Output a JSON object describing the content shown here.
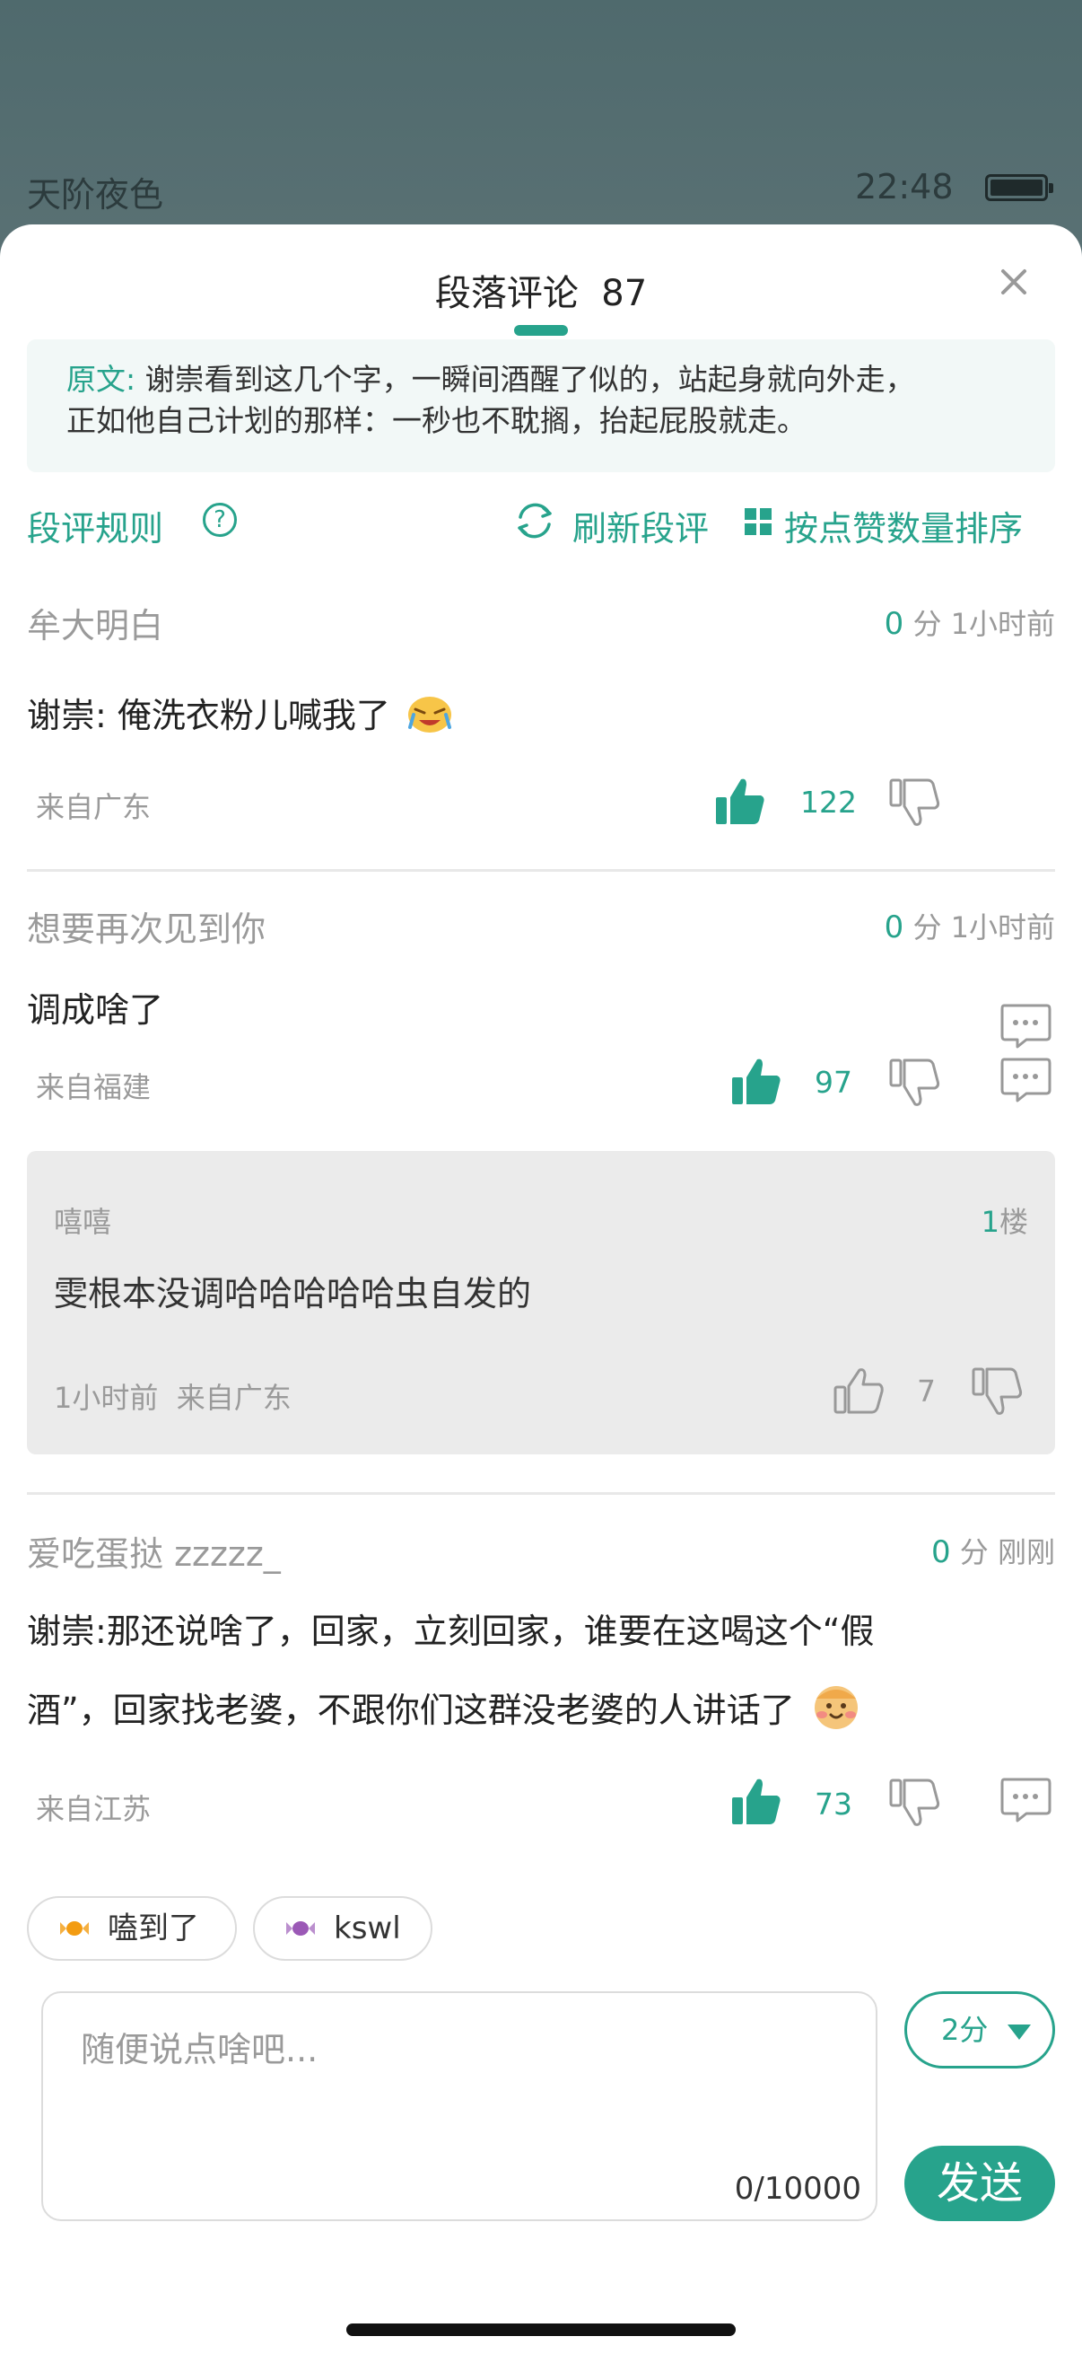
{
  "status": {
    "app_name": "天阶夜色",
    "time": "22:48"
  },
  "header": {
    "title": "段落评论",
    "count": "87"
  },
  "quote": {
    "label": "原文:",
    "text_line1": "谢崇看到这几个字，一瞬间酒醒了似的，站起身就向外走，",
    "text_line2": "正如他自己计划的那样：一秒也不耽搁，抬起屁股就走。"
  },
  "toolbar": {
    "rules": "段评规则",
    "help_icon": "?",
    "refresh": "刷新段评",
    "sort": "按点赞数量排序"
  },
  "comments": [
    {
      "user": "牟大明白",
      "score": "0",
      "score_unit": "分",
      "time": "1小时前",
      "body": "谢崇: 俺洗衣粉儿喊我了",
      "emoji": "crying-laughing-emoji",
      "location": "来自广东",
      "likes": "122"
    },
    {
      "user": "想要再次见到你",
      "score": "0",
      "score_unit": "分",
      "time": "1小时前",
      "body": "调成啥了",
      "location": "来自福建",
      "likes": "97",
      "reply": {
        "user": "嘻嘻",
        "floor_num": "1",
        "floor_unit": "楼",
        "body": "雯根本没调哈哈哈哈哈虫自发的",
        "time": "1小时前",
        "location": "来自广东",
        "likes": "7"
      }
    },
    {
      "user": "爱吃蛋挞 zzzzz_",
      "score": "0",
      "score_unit": "分",
      "time": "刚刚",
      "body_line1": "谢崇:那还说啥了，回家，立刻回家，谁要在这喝这个“假",
      "body_line2": "酒”，回家找老婆，不跟你们这群没老婆的人讲话了",
      "emoji": "tiger-emoji",
      "location": "来自江苏",
      "likes": "73"
    }
  ],
  "chips": [
    {
      "label": "嗑到了",
      "icon": "candy-orange-icon"
    },
    {
      "label": "kswl",
      "icon": "candy-purple-icon"
    }
  ],
  "composer": {
    "placeholder": "随便说点啥吧...",
    "counter": "0/10000",
    "score": "2分",
    "send": "发送"
  },
  "colors": {
    "accent": "#27a38c"
  }
}
